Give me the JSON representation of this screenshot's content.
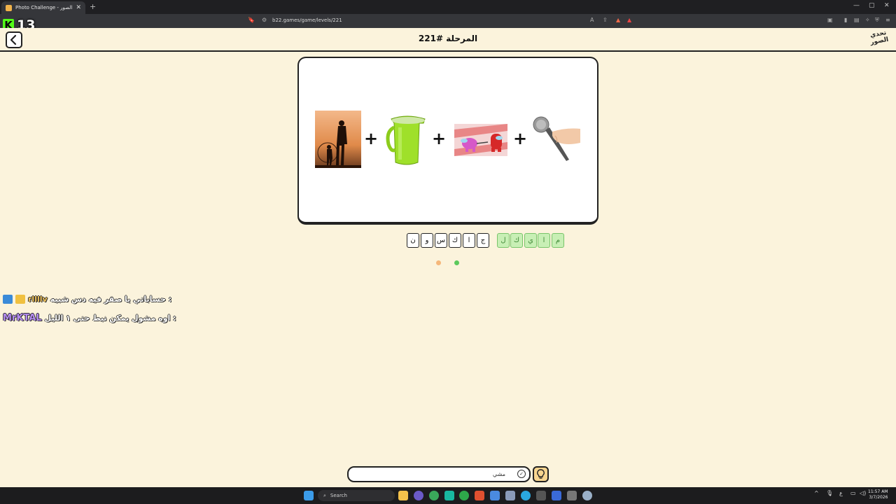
{
  "browser": {
    "tab_title": "Photo Challenge - تحدي الصور",
    "url": "b22.games/game/levels/221"
  },
  "overlay": {
    "counter": "13",
    "k_logo": "K"
  },
  "header": {
    "level_title": "المرحلة #221",
    "logo_text": "تحدي الصور"
  },
  "puzzle": {
    "images": [
      "father-and-son-image",
      "green-jug-image",
      "among-us-image",
      "microphone-image"
    ]
  },
  "slots": {
    "guess_letters": [
      "ن",
      "و",
      "س",
      "ك",
      "ا",
      "ج"
    ],
    "revealed_letters": [
      "ل",
      "ك",
      "ي",
      "ا",
      "م"
    ]
  },
  "chat": [
    {
      "user": "rllllv",
      "message": "حساباتي يا صقر فيه دس شبيه :"
    },
    {
      "user": "MrKTAL",
      "message": "اوه مشول يمكن نبط حتى ١ الليل :"
    }
  ],
  "answer": {
    "text": "مشي"
  },
  "taskbar": {
    "search_label": "Search",
    "time": "11:57 AM",
    "date": "3/7/2026"
  },
  "colors": {
    "background": "#fbf3dc",
    "accent_green": "#c8efb5",
    "counter_green": "#53fc18",
    "chat_user1": "#f0c35a",
    "chat_user2": "#b48cf0"
  }
}
